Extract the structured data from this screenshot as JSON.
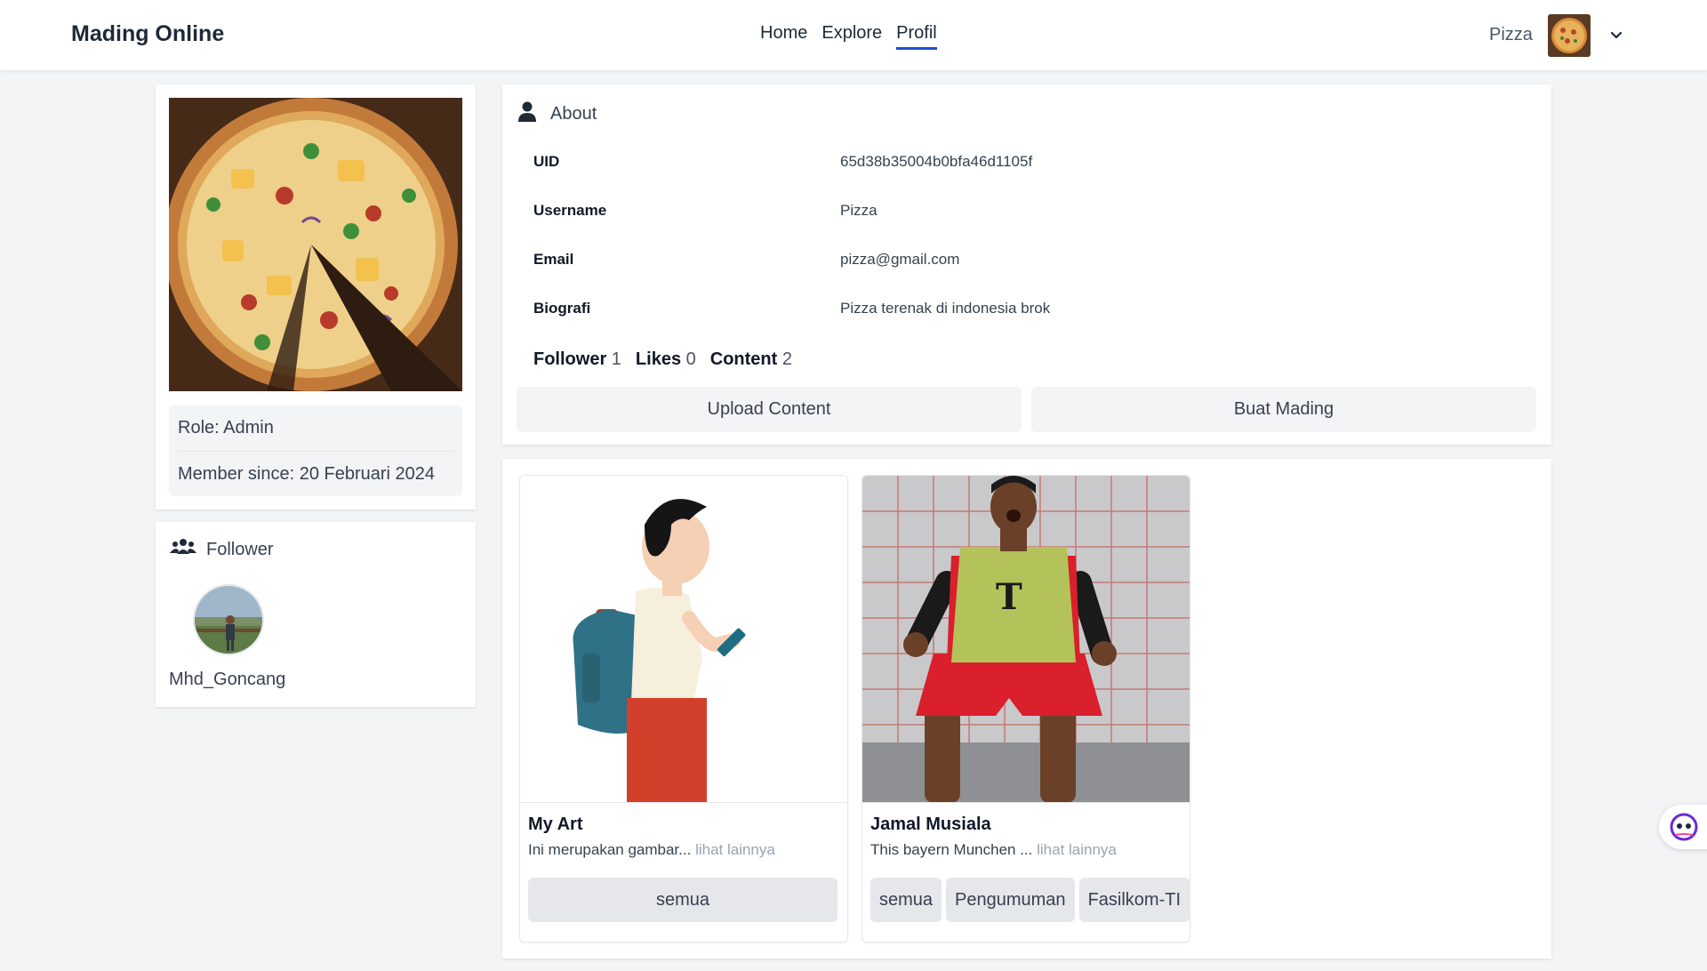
{
  "header": {
    "brand": "Mading Online",
    "nav": [
      {
        "label": "Home"
      },
      {
        "label": "Explore"
      },
      {
        "label": "Profil",
        "active": true
      }
    ],
    "user_name": "Pizza",
    "avatar_icon": "pizza-photo",
    "menu_icon": "chevron-down-icon"
  },
  "profile": {
    "role": "Role: Admin",
    "member_since": "Member since: 20 Februari 2024"
  },
  "followers": {
    "title": "Follower",
    "icon": "users-icon",
    "items": [
      {
        "name": "Mhd_Goncang"
      }
    ]
  },
  "about": {
    "title": "About",
    "icon": "user-icon",
    "fields": [
      {
        "label": "UID",
        "value": "65d38b35004b0bfa46d1105f"
      },
      {
        "label": "Username",
        "value": "Pizza"
      },
      {
        "label": "Email",
        "value": "pizza@gmail.com"
      },
      {
        "label": "Biografi",
        "value": "Pizza terenak di indonesia brok"
      }
    ],
    "stats": {
      "follower_label": "Follower",
      "follower_count": "1",
      "likes_label": "Likes",
      "likes_count": "0",
      "content_label": "Content",
      "content_count": "2"
    },
    "buttons": {
      "upload": "Upload Content",
      "mading": "Buat Mading"
    }
  },
  "posts": [
    {
      "title": "My Art",
      "desc": "Ini merupakan gambar...",
      "more": "lihat lainnya",
      "tags": [
        "semua"
      ]
    },
    {
      "title": "Jamal Musiala",
      "desc": "This bayern Munchen ...",
      "more": "lihat lainnya",
      "tags": [
        "semua",
        "Pengumuman",
        "Fasilkom-TI"
      ]
    }
  ],
  "colors": {
    "accent": "#1d4ed8",
    "background": "#f3f4f6",
    "chip": "#e5e7eb"
  }
}
